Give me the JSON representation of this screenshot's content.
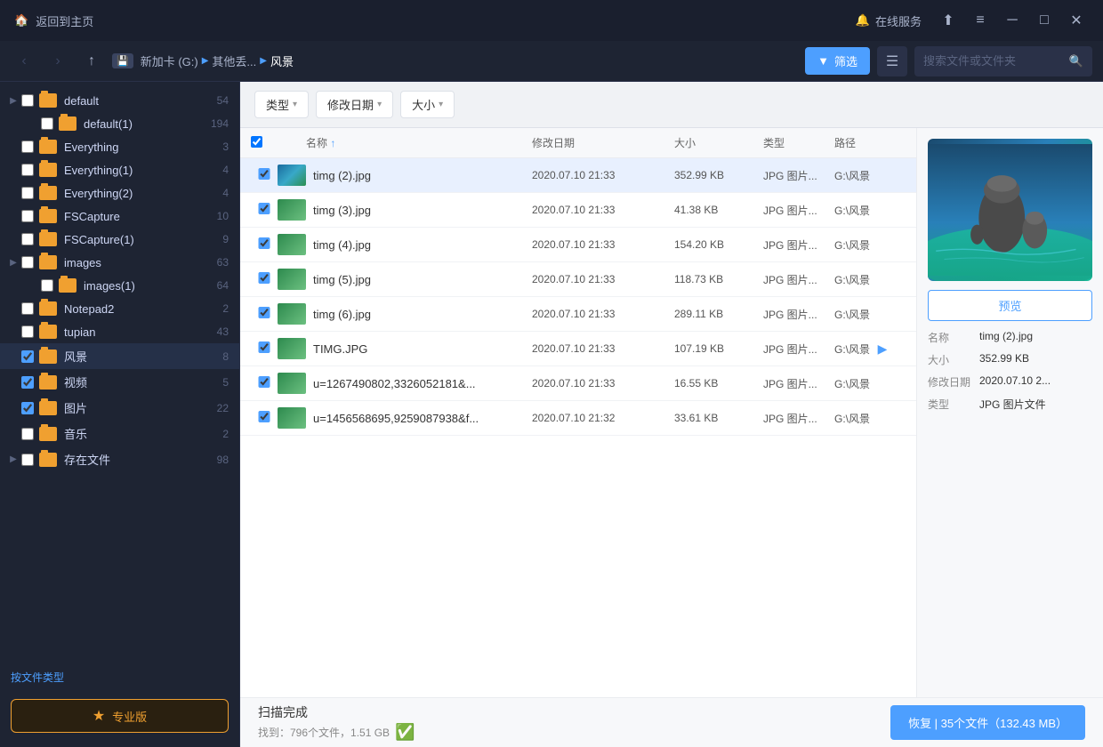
{
  "titlebar": {
    "home_label": "返回到主页",
    "online_service": "在线服务",
    "share_icon": "⬆",
    "menu_icon": "≡",
    "min_icon": "─",
    "max_icon": "□",
    "close_icon": "✕"
  },
  "toolbar": {
    "back_btn": "‹",
    "forward_btn": "›",
    "up_btn": "↑",
    "drive": "新加卡 (G:)",
    "path1": "其他丢...",
    "path2": "风景",
    "filter_btn": "筛选",
    "search_placeholder": "搜索文件或文件夹"
  },
  "filter_bar": {
    "type_label": "类型",
    "date_label": "修改日期",
    "size_label": "大小",
    "arrow": "▾"
  },
  "table": {
    "headers": {
      "name": "名称",
      "date": "修改日期",
      "size": "大小",
      "type": "类型",
      "path": "路径"
    },
    "rows": [
      {
        "name": "timg (2).jpg",
        "date": "2020.07.10 21:33",
        "size": "352.99 KB",
        "type": "JPG 图片...",
        "path": "G:\\风景",
        "selected": true,
        "thumb_type": "sea"
      },
      {
        "name": "timg (3).jpg",
        "date": "2020.07.10 21:33",
        "size": "41.38 KB",
        "type": "JPG 图片...",
        "path": "G:\\风景",
        "selected": true,
        "thumb_type": "green"
      },
      {
        "name": "timg (4).jpg",
        "date": "2020.07.10 21:33",
        "size": "154.20 KB",
        "type": "JPG 图片...",
        "path": "G:\\风景",
        "selected": true,
        "thumb_type": "green"
      },
      {
        "name": "timg (5).jpg",
        "date": "2020.07.10 21:33",
        "size": "118.73 KB",
        "type": "JPG 图片...",
        "path": "G:\\风景",
        "selected": true,
        "thumb_type": "green"
      },
      {
        "name": "timg (6).jpg",
        "date": "2020.07.10 21:33",
        "size": "289.11 KB",
        "type": "JPG 图片...",
        "path": "G:\\风景",
        "selected": true,
        "thumb_type": "green"
      },
      {
        "name": "TIMG.JPG",
        "date": "2020.07.10 21:33",
        "size": "107.19 KB",
        "type": "JPG 图片...",
        "path": "G:\\风景",
        "selected": true,
        "thumb_type": "green",
        "has_play": true
      },
      {
        "name": "u=1267490802,3326052181&...",
        "date": "2020.07.10 21:33",
        "size": "16.55 KB",
        "type": "JPG 图片...",
        "path": "G:\\风景",
        "selected": true,
        "thumb_type": "green"
      },
      {
        "name": "u=1456568695,9259087938f...",
        "date": "2020.07.10 21:32",
        "size": "33.61 KB",
        "type": "JPG 图片...",
        "path": "G:\\风景",
        "selected": true,
        "thumb_type": "green"
      }
    ]
  },
  "sidebar": {
    "items": [
      {
        "name": "default",
        "count": "54",
        "has_arrow": true,
        "checked": false,
        "checked_state": "false"
      },
      {
        "name": "default(1)",
        "count": "194",
        "has_arrow": false,
        "checked": false,
        "indent": true
      },
      {
        "name": "Everything",
        "count": "3",
        "has_arrow": false,
        "checked": false
      },
      {
        "name": "Everything(1)",
        "count": "4",
        "has_arrow": false,
        "checked": false
      },
      {
        "name": "Everything(2)",
        "count": "4",
        "has_arrow": false,
        "checked": false
      },
      {
        "name": "FSCapture",
        "count": "10",
        "has_arrow": false,
        "checked": false
      },
      {
        "name": "FSCapture(1)",
        "count": "9",
        "has_arrow": false,
        "checked": false
      },
      {
        "name": "images",
        "count": "63",
        "has_arrow": true,
        "checked": false
      },
      {
        "name": "images(1)",
        "count": "64",
        "has_arrow": false,
        "checked": false,
        "indent": true
      },
      {
        "name": "Notepad2",
        "count": "2",
        "has_arrow": false,
        "checked": false
      },
      {
        "name": "tupian",
        "count": "43",
        "has_arrow": false,
        "checked": false
      },
      {
        "name": "风景",
        "count": "8",
        "has_arrow": false,
        "checked": true,
        "active": true
      },
      {
        "name": "视频",
        "count": "5",
        "has_arrow": false,
        "checked": true
      },
      {
        "name": "图片",
        "count": "22",
        "has_arrow": false,
        "checked": true
      },
      {
        "name": "音乐",
        "count": "2",
        "has_arrow": false,
        "checked": false
      },
      {
        "name": "存在文件",
        "count": "98",
        "has_arrow": true,
        "checked": false
      }
    ],
    "footer_label": "按文件类型",
    "premium_label": "专业版"
  },
  "right_panel": {
    "preview_label": "预览",
    "file_info": {
      "name_label": "名称",
      "name_value": "timg (2).jpg",
      "size_label": "大小",
      "size_value": "352.99 KB",
      "date_label": "修改日期",
      "date_value": "2020.07.10 2...",
      "type_label": "类型",
      "type_value": "JPG 图片文件"
    }
  },
  "statusbar": {
    "scan_title": "扫描完成",
    "scan_detail": "找到：796个文件，1.51 GB",
    "restore_btn": "恢复 | 35个文件（132.43 MB）"
  }
}
